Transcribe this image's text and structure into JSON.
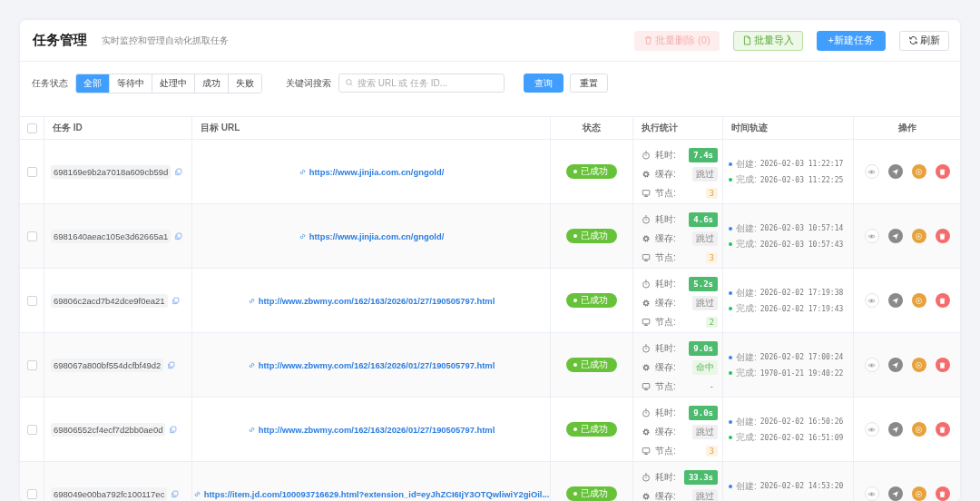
{
  "header": {
    "title": "任务管理",
    "subtitle": "实时监控和管理自动化抓取任务",
    "buttons": [
      {
        "kind": "delete",
        "label": "批量删除 (0)",
        "disabled": true
      },
      {
        "kind": "import",
        "label": "批量导入",
        "disabled": false
      },
      {
        "kind": "create",
        "label": "+新建任务",
        "disabled": false
      },
      {
        "kind": "refresh",
        "label": "刷新",
        "disabled": false
      }
    ]
  },
  "filters": {
    "status_label": "任务状态",
    "tabs": [
      {
        "label": "全部",
        "selected": true
      },
      {
        "label": "等待中",
        "selected": false
      },
      {
        "label": "处理中",
        "selected": false
      },
      {
        "label": "成功",
        "selected": false
      },
      {
        "label": "失败",
        "selected": false
      }
    ],
    "search_label": "关键词搜索",
    "search": {
      "placeholder": "搜索 URL 或 任务 ID..."
    },
    "query_button": "查询",
    "reset_button": "重置"
  },
  "table": {
    "header_checked": false,
    "columns": [
      "任务 ID",
      "目标 URL",
      "状态",
      "执行统计",
      "时间轨迹",
      "操作"
    ],
    "rows": [
      {
        "checked": false,
        "id": "698169e9b2a7018a609cb59d",
        "url": "https://www.jinjia.com.cn/gngold/",
        "status": {
          "kind": "success",
          "label": "已成功"
        },
        "stats": [
          {
            "kind": "duration",
            "label": "耗时:",
            "value": "7.4s",
            "color": "#4cbb6e"
          },
          {
            "kind": "cache",
            "label": "缓存:",
            "value": "跳过",
            "color": "#f0f0f2"
          },
          {
            "kind": "node",
            "label": "节点:",
            "value": "3",
            "color": "#fdf3e4"
          }
        ],
        "timeline": [
          {
            "label": "创建:",
            "time": "2026-02-03 11:22:17",
            "color": "#3b82f6"
          },
          {
            "label": "完成:",
            "time": "2026-02-03 11:22:25",
            "color": "#22c55e"
          }
        ]
      },
      {
        "checked": false,
        "id": "6981640aeac105e3d62665a1",
        "url": "https://www.jinjia.com.cn/gngold/",
        "status": {
          "kind": "success",
          "label": "已成功"
        },
        "stats": [
          {
            "kind": "duration",
            "label": "耗时:",
            "value": "4.6s",
            "color": "#4cbb6e"
          },
          {
            "kind": "cache",
            "label": "缓存:",
            "value": "跳过",
            "color": "#f0f0f2"
          },
          {
            "kind": "node",
            "label": "节点:",
            "value": "3",
            "color": "#fdf3e4"
          }
        ],
        "timeline": [
          {
            "label": "创建:",
            "time": "2026-02-03 10:57:14",
            "color": "#3b82f6"
          },
          {
            "label": "完成:",
            "time": "2026-02-03 10:57:43",
            "color": "#22c55e"
          }
        ]
      },
      {
        "checked": false,
        "id": "69806c2acd7b42dce9f0ea21",
        "url": "http://www.zbwmy.com/162/163/2026/01/27/190505797.html",
        "status": {
          "kind": "success",
          "label": "已成功"
        },
        "stats": [
          {
            "kind": "duration",
            "label": "耗时:",
            "value": "5.2s",
            "color": "#4cbb6e"
          },
          {
            "kind": "cache",
            "label": "缓存:",
            "value": "跳过",
            "color": "#f0f0f2"
          },
          {
            "kind": "node",
            "label": "节点:",
            "value": "2",
            "color": "#eaf7e6"
          }
        ],
        "timeline": [
          {
            "label": "创建:",
            "time": "2026-02-02 17:19:38",
            "color": "#3b82f6"
          },
          {
            "label": "完成:",
            "time": "2026-02-02 17:19:43",
            "color": "#22c55e"
          }
        ]
      },
      {
        "checked": false,
        "id": "698067a800bf554dcfbf49d2",
        "url": "http://www.zbwmy.com/162/163/2026/01/27/190505797.html",
        "status": {
          "kind": "success",
          "label": "已成功"
        },
        "stats": [
          {
            "kind": "duration",
            "label": "耗时:",
            "value": "9.0s",
            "color": "#4cbb6e"
          },
          {
            "kind": "cache",
            "label": "缓存:",
            "value": "命中",
            "color": "#eaf7e6"
          },
          {
            "kind": "node",
            "label": "节点:",
            "value": "-"
          }
        ],
        "timeline": [
          {
            "label": "创建:",
            "time": "2026-02-02 17:00:24",
            "color": "#3b82f6"
          },
          {
            "label": "完成:",
            "time": "1970-01-21 19:40:22",
            "color": "#22c55e"
          }
        ]
      },
      {
        "checked": false,
        "id": "69806552cf4ecf7d2bb0ae0d",
        "url": "http://www.zbwmy.com/162/163/2026/01/27/190505797.html",
        "status": {
          "kind": "success",
          "label": "已成功"
        },
        "stats": [
          {
            "kind": "duration",
            "label": "耗时:",
            "value": "9.0s",
            "color": "#4cbb6e"
          },
          {
            "kind": "cache",
            "label": "缓存:",
            "value": "跳过",
            "color": "#f0f0f2"
          },
          {
            "kind": "node",
            "label": "节点:",
            "value": "3",
            "color": "#fdf3e4"
          }
        ],
        "timeline": [
          {
            "label": "创建:",
            "time": "2026-02-02 16:50:26",
            "color": "#3b82f6"
          },
          {
            "label": "完成:",
            "time": "2026-02-02 16:51:09",
            "color": "#22c55e"
          }
        ]
      },
      {
        "checked": false,
        "id": "698049e00ba792fc100117ec",
        "url": "https://item.jd.com/100093716629.html?extension_id=eyJhZCI6IjY3OTQwliwiY2giOil...",
        "status": {
          "kind": "success",
          "label": "已成功"
        },
        "stats": [
          {
            "kind": "duration",
            "label": "耗时:",
            "value": "33.3s",
            "color": "#4cbb6e"
          },
          {
            "kind": "cache",
            "label": "缓存:",
            "value": "跳过",
            "color": "#f0f0f2"
          }
        ],
        "timeline": [
          {
            "label": "创建:",
            "time": "2026-02-02 14:53:20",
            "color": "#3b82f6"
          }
        ]
      }
    ]
  }
}
